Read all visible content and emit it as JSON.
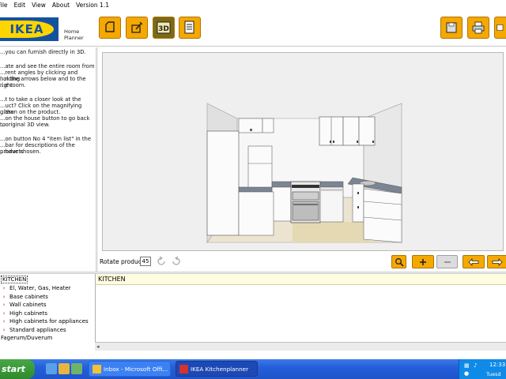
{
  "menu": [
    "File",
    "Edit",
    "View",
    "About",
    "Version 1.1"
  ],
  "header": {
    "logo_text": "IKEA",
    "logo_reg": "®",
    "app_name_line1": "Home",
    "app_name_line2": "Planner",
    "toolbar_left": [
      "draw-room-icon",
      "edit-room-icon",
      "3d-view-icon",
      "item-list-icon"
    ],
    "toolbar_right": [
      "save-icon",
      "print-icon",
      "exit-icon"
    ]
  },
  "help": {
    "p1": "...you can furnish directly in 3D.",
    "p2_lines": [
      "...ate and see the entire room from",
      "...rent angles by clicking and holding",
      "...n the arrows below and to the right",
      "...e room."
    ],
    "p3_lines": [
      "...t to take a closer look at the",
      "...uct? Click on the magnifying glass",
      "...then on the product.",
      "...on the house button to go back to",
      "...original 3D view."
    ],
    "p4_lines": [
      "...on button No 4 \"item list\" in the",
      "...bar for descriptions of the products",
      "...have chosen."
    ]
  },
  "viewer": {
    "rotate_label": "Rotate product:",
    "rotate_value": "45"
  },
  "tree": {
    "root": "KITCHEN",
    "items": [
      "El, Water, Gas, Heater",
      "Base cabinets",
      "Wall cabinets",
      "High cabinets",
      "High cabinets for appliances",
      "Standard appliances"
    ],
    "footer": "Fagerum/Duverum"
  },
  "item_list": {
    "title": "KITCHEN"
  },
  "taskbar": {
    "start_label": "start",
    "tasks": [
      {
        "label": "Inbox - Microsoft Offi...",
        "active": false
      },
      {
        "label": "IKEA Kitchenplanner",
        "active": true
      }
    ],
    "time": "12:33",
    "day": "Tuesd"
  },
  "colors": {
    "accent": "#f5a800",
    "ikea_blue": "#1452a0",
    "ikea_yellow": "#ffd500",
    "taskbar": "#245edb"
  }
}
